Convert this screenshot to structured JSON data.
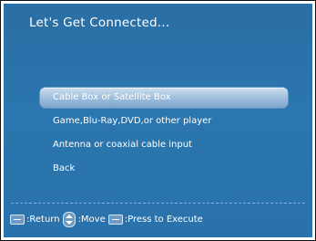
{
  "screen": {
    "title": "Let's Get Connected..."
  },
  "menu": {
    "items": [
      {
        "label": "Cable Box or Satellite Box",
        "selected": true
      },
      {
        "label": "Game,Blu-Ray,DVD,or other player",
        "selected": false
      },
      {
        "label": "Antenna or coaxial cable input",
        "selected": false
      },
      {
        "label": "Back",
        "selected": false
      }
    ]
  },
  "footer": {
    "return_label": ":Return",
    "move_label": ":Move",
    "execute_label": ":Press to Execute",
    "icons": [
      "menu-key-icon",
      "up-down-key-icon",
      "enter-key-icon"
    ]
  },
  "colors": {
    "background": "#2a70a9",
    "selected_highlight": "#a9c5e1",
    "text": "#ffffff"
  }
}
